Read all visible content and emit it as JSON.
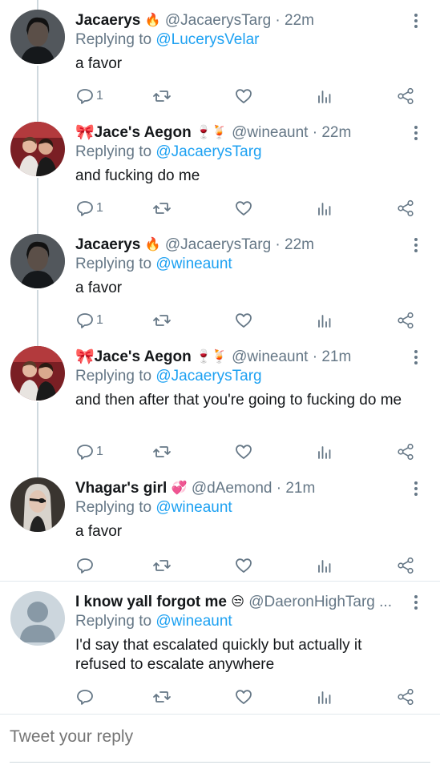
{
  "tweets": [
    {
      "name": "Jacaerys",
      "emoji": "🔥",
      "handle": "@JacaerysTarg",
      "time": "· 22m",
      "reply_prefix": "Replying to ",
      "reply_to": "@LucerysVelar",
      "text": "a favor",
      "reply_count": "1",
      "avatar": "dark-haired-man-avatar"
    },
    {
      "name": "🎀Jace's Aegon",
      "emoji": "🍷🍹",
      "handle": "@wineaunt",
      "time": "· 22m",
      "reply_prefix": "Replying to ",
      "reply_to": "@JacaerysTarg",
      "text": "and fucking do me",
      "reply_count": "1",
      "avatar": "two-men-photo-avatar"
    },
    {
      "name": "Jacaerys",
      "emoji": "🔥",
      "handle": "@JacaerysTarg",
      "time": "· 22m",
      "reply_prefix": "Replying to ",
      "reply_to": "@wineaunt",
      "text": "a favor",
      "reply_count": "1",
      "avatar": "dark-haired-man-avatar"
    },
    {
      "name": "🎀Jace's Aegon",
      "emoji": "🍷🍹",
      "handle": "@wineaunt",
      "time": "· 21m",
      "reply_prefix": "Replying to ",
      "reply_to": "@JacaerysTarg",
      "text": "and then after that you're going to fucking do me",
      "reply_count": "1",
      "avatar": "two-men-photo-avatar"
    },
    {
      "name": "Vhagar's girl",
      "emoji": "💞",
      "handle": "@dAemond",
      "time": "· 21m",
      "reply_prefix": "Replying to ",
      "reply_to": "@wineaunt",
      "text": "a favor",
      "reply_count": "",
      "avatar": "silver-haired-eyepatch-avatar"
    },
    {
      "name": "I know yall forgot me",
      "emoji": "😒",
      "handle": "@DaeronHighTarg ...",
      "time": "",
      "reply_prefix": "Replying to ",
      "reply_to": "@wineaunt",
      "text": "I'd say that escalated quickly but actually it refused to escalate anywhere",
      "reply_count": "",
      "avatar": "default-profile-avatar"
    }
  ],
  "compose": {
    "placeholder": "Tweet your reply"
  },
  "colors": {
    "link": "#1da1f2",
    "secondary_text": "#657786",
    "divider": "#e1e8ed"
  }
}
